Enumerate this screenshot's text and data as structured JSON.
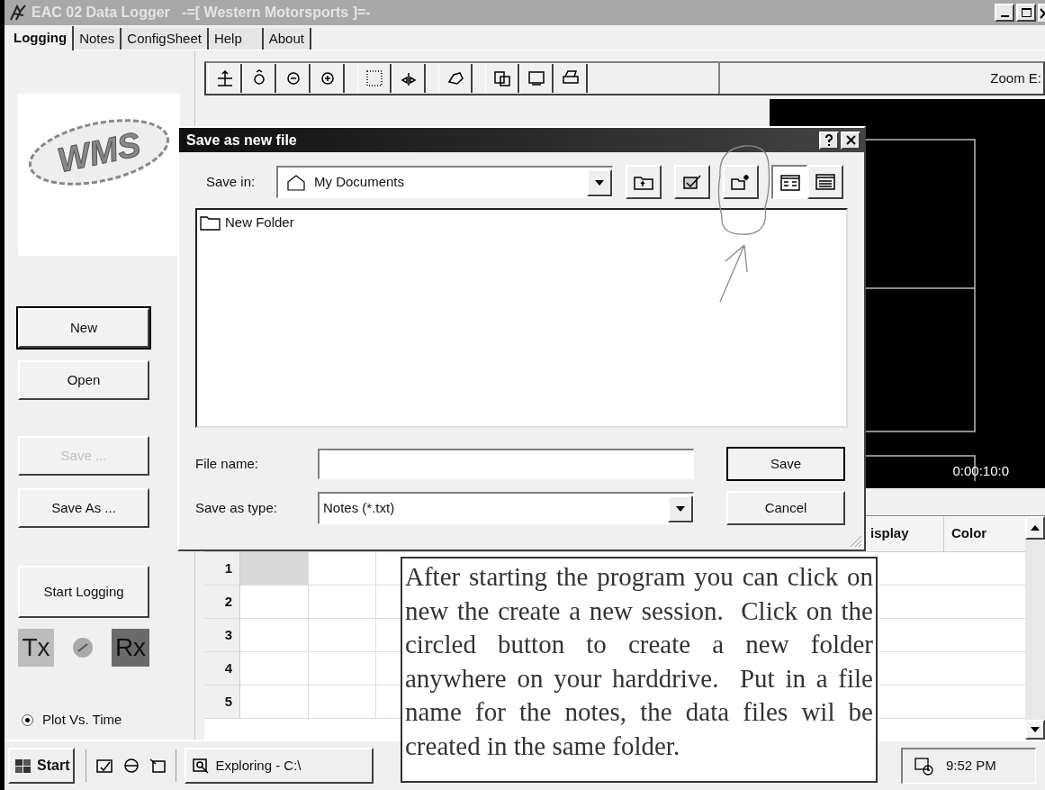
{
  "window": {
    "title": "EAC 02 Data Logger   -=[ Western Motorsports ]=-"
  },
  "tabs": [
    {
      "label": "Logging",
      "selected": true
    },
    {
      "label": "Notes",
      "selected": false
    },
    {
      "label": "ConfigSheet",
      "selected": false
    },
    {
      "label": "Help",
      "selected": false
    },
    {
      "label": "About",
      "selected": false
    }
  ],
  "sidebar": {
    "logo": "WMS",
    "buttons": [
      {
        "label": "New",
        "disabled": false,
        "default": true
      },
      {
        "label": "Open",
        "disabled": false,
        "default": false
      },
      {
        "label": "Save ...",
        "disabled": true,
        "default": false
      },
      {
        "label": "Save As ...",
        "disabled": false,
        "default": false
      }
    ],
    "start_logging": "Start Logging",
    "tx": "Tx",
    "rx": "Rx",
    "radio": {
      "label": "Plot Vs. Time",
      "checked": true
    }
  },
  "toolbar": {
    "zoom_label": "Zoom E:"
  },
  "chart": {
    "time_label": "0:00:10:0"
  },
  "grid": {
    "columns": [
      "isplay",
      "Color"
    ],
    "rows": [
      "1",
      "2",
      "3",
      "4",
      "5"
    ]
  },
  "dialog": {
    "title": "Save as new file",
    "save_in_label": "Save in:",
    "save_in_value": "My Documents",
    "files": [
      {
        "name": "New Folder"
      }
    ],
    "file_name_label": "File name:",
    "save_type_label": "Save as type:",
    "save_type_value": "Notes (*.txt)",
    "buttons": [
      "Save",
      "Cancel"
    ]
  },
  "annotation": {
    "text": "After starting the program you can click on new the create a new session.  Click on the circled button to create a new folder anywhere on your harddrive.  Put in a file name for the notes, the data files wil be created in the same folder."
  },
  "taskbar": {
    "start": "Start",
    "task": "Exploring - C:\\",
    "clock": "9:52 PM"
  }
}
